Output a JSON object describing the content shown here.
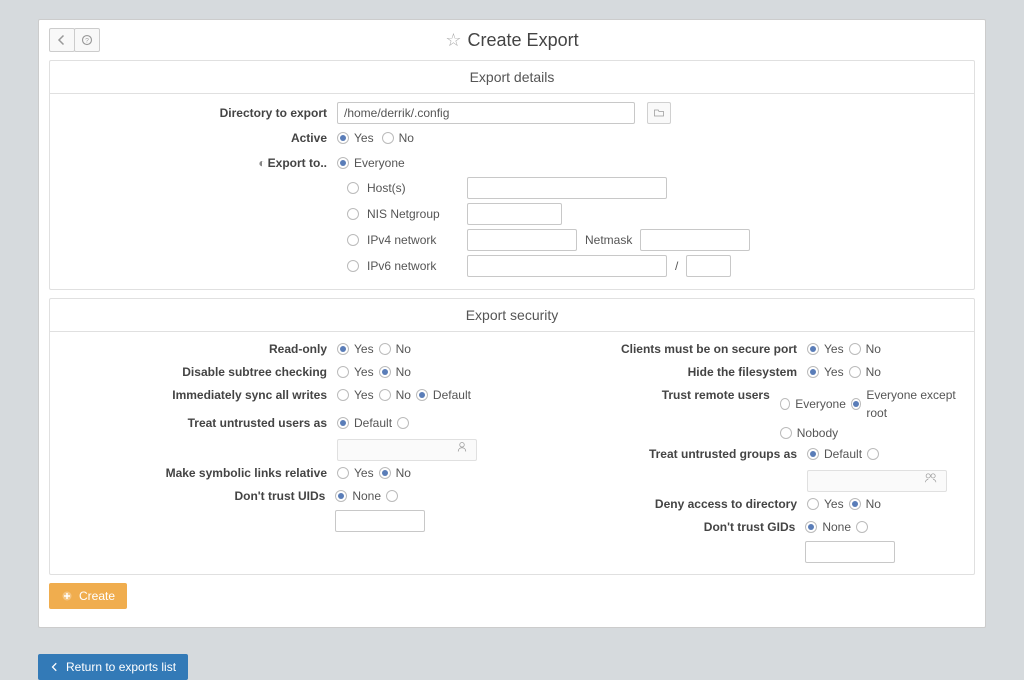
{
  "header": {
    "title": "Create Export"
  },
  "details": {
    "heading": "Export details",
    "directory_label": "Directory to export",
    "directory_value": "/home/derrik/.config",
    "active_label": "Active",
    "yes": "Yes",
    "no": "No",
    "export_to_label": "Export to..",
    "opt_everyone": "Everyone",
    "opt_hosts": "Host(s)",
    "opt_nis": "NIS Netgroup",
    "opt_ipv4": "IPv4 network",
    "netmask": "Netmask",
    "opt_ipv6": "IPv6 network",
    "slash": "/"
  },
  "security": {
    "heading": "Export security",
    "readonly": "Read-only",
    "disable_subtree": "Disable subtree checking",
    "sync_writes": "Immediately sync all writes",
    "default": "Default",
    "treat_users": "Treat untrusted users as",
    "make_symlinks": "Make symbolic links relative",
    "dont_trust_uids": "Don't trust UIDs",
    "none": "None",
    "clients_secure": "Clients must be on secure port",
    "hide_fs": "Hide the filesystem",
    "trust_remote": "Trust remote users",
    "everyone": "Everyone",
    "everyone_except_root": "Everyone except root",
    "nobody": "Nobody",
    "treat_groups": "Treat untrusted groups as",
    "deny_access": "Deny access to directory",
    "dont_trust_gids": "Don't trust GIDs"
  },
  "buttons": {
    "create": "Create",
    "return": "Return to exports list"
  }
}
